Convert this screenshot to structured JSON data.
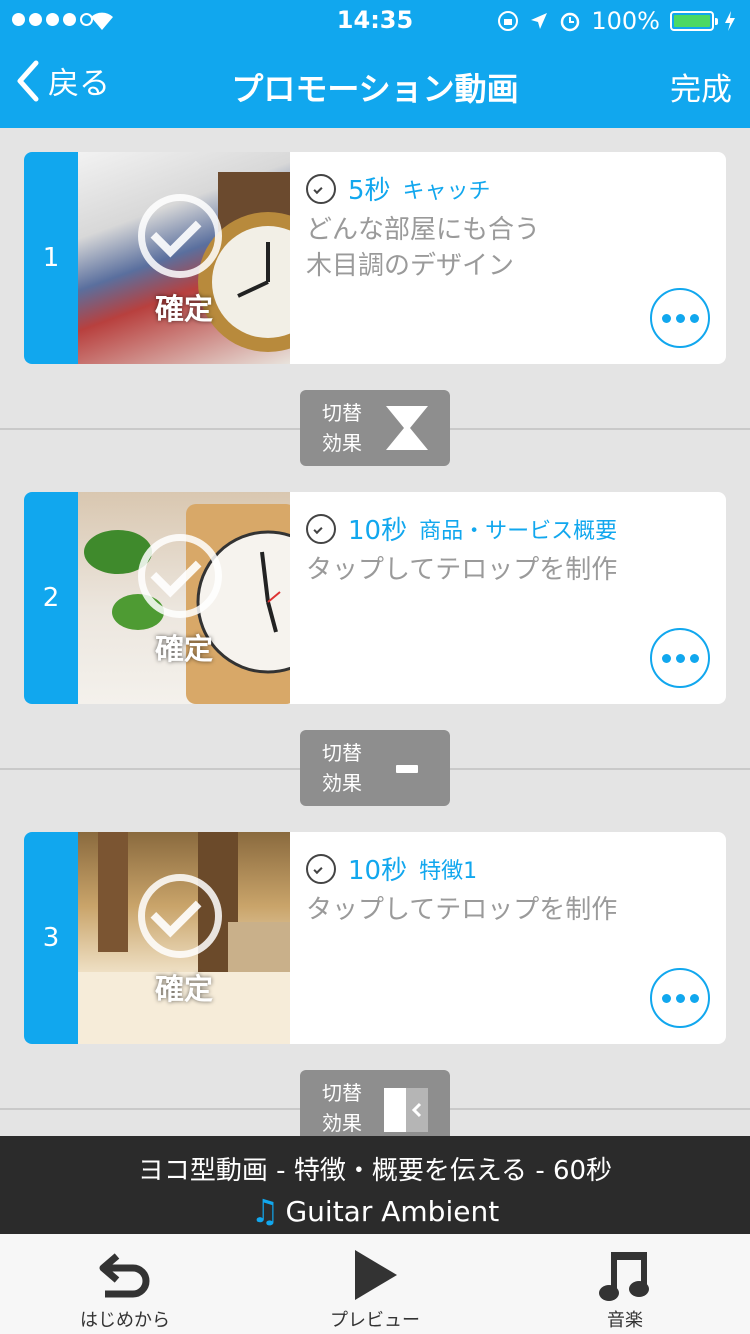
{
  "status_bar": {
    "time": "14:35",
    "battery": "100%",
    "signal_dots_filled": 4,
    "signal_dots_total": 5
  },
  "nav": {
    "back_label": "戻る",
    "title": "プロモーション動画",
    "done_label": "完成"
  },
  "scenes": [
    {
      "index": "1",
      "duration": "5秒",
      "category": "キャッチ",
      "caption": "どんな部屋にも合う\n木目調のデザイン",
      "confirm_label": "確定",
      "thumb_icon": "pocket-watch-icon"
    },
    {
      "index": "2",
      "duration": "10秒",
      "category": "商品・サービス概要",
      "caption": "タップしてテロップを制作",
      "confirm_label": "確定",
      "thumb_icon": "wooden-clock-icon"
    },
    {
      "index": "3",
      "duration": "10秒",
      "category": "特徴1",
      "caption": "タップしてテロップを制作",
      "confirm_label": "確定",
      "thumb_icon": "hotel-room-icon"
    }
  ],
  "transitions": [
    {
      "label": "切替\n効果",
      "icon": "hourglass-icon"
    },
    {
      "label": "切替\n効果",
      "icon": "minus-icon"
    },
    {
      "label": "切替\n効果",
      "icon": "slide-in-icon"
    }
  ],
  "info_bar": {
    "summary": "ヨコ型動画 - 特徴・概要を伝える - 60秒",
    "music_title": "Guitar Ambient",
    "music_icon": "music-note-icon"
  },
  "tabs": [
    {
      "label": "はじめから",
      "icon": "restart-icon"
    },
    {
      "label": "プレビュー",
      "icon": "play-icon"
    },
    {
      "label": "音楽",
      "icon": "music-note-icon"
    }
  ],
  "colors": {
    "accent": "#11a7ee",
    "background": "#e4e4e4",
    "transition_bg": "#8e8e8e",
    "info_bar_bg": "#2b2b2b"
  }
}
